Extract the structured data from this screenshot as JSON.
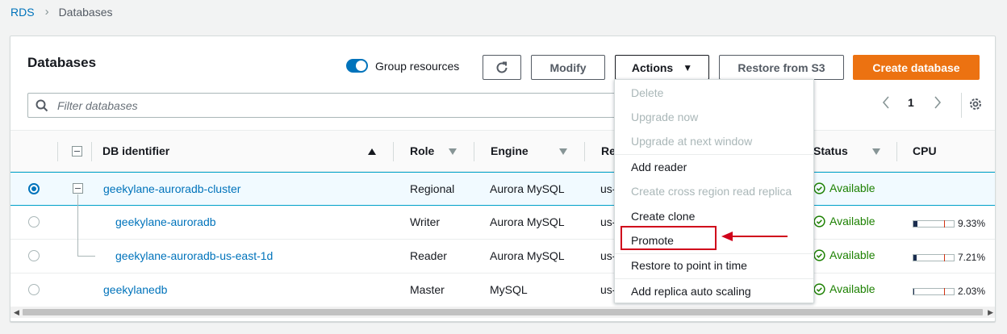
{
  "breadcrumb": {
    "root": "RDS",
    "current": "Databases"
  },
  "panel": {
    "title": "Databases"
  },
  "toggle": {
    "label": "Group resources",
    "on": true
  },
  "toolbar": {
    "modify": "Modify",
    "actions": "Actions",
    "restore_s3": "Restore from S3",
    "create": "Create database"
  },
  "filter": {
    "placeholder": "Filter databases"
  },
  "pager": {
    "page": "1"
  },
  "columns": {
    "id": "DB identifier",
    "role": "Role",
    "engine": "Engine",
    "region": "Re",
    "status": "Status",
    "cpu": "CPU"
  },
  "rows": [
    {
      "id": "geekylane-auroradb-cluster",
      "role": "Regional",
      "engine": "Aurora MySQL",
      "region": "us-",
      "status": "Available",
      "cpu": ""
    },
    {
      "id": "geekylane-auroradb",
      "role": "Writer",
      "engine": "Aurora MySQL",
      "region": "us-",
      "status": "Available",
      "cpu": "9.33%",
      "cpu_fraction": 0.0933
    },
    {
      "id": "geekylane-auroradb-us-east-1d",
      "role": "Reader",
      "engine": "Aurora MySQL",
      "region": "us-",
      "status": "Available",
      "cpu": "7.21%",
      "cpu_fraction": 0.0721
    },
    {
      "id": "geekylanedb",
      "role": "Master",
      "engine": "MySQL",
      "region": "us-",
      "status": "Available",
      "cpu": "2.03%",
      "cpu_fraction": 0.0203
    }
  ],
  "menu": {
    "delete": "Delete",
    "upgrade_now": "Upgrade now",
    "upgrade_next": "Upgrade at next window",
    "add_reader": "Add reader",
    "cross_region": "Create cross region read replica",
    "create_clone": "Create clone",
    "promote": "Promote",
    "restore_pit": "Restore to point in time",
    "replica_scaling": "Add replica auto scaling"
  },
  "colors": {
    "accent": "#0073bb",
    "primary_button": "#ec7211",
    "success": "#1d8102",
    "annotation": "#d0021b"
  }
}
